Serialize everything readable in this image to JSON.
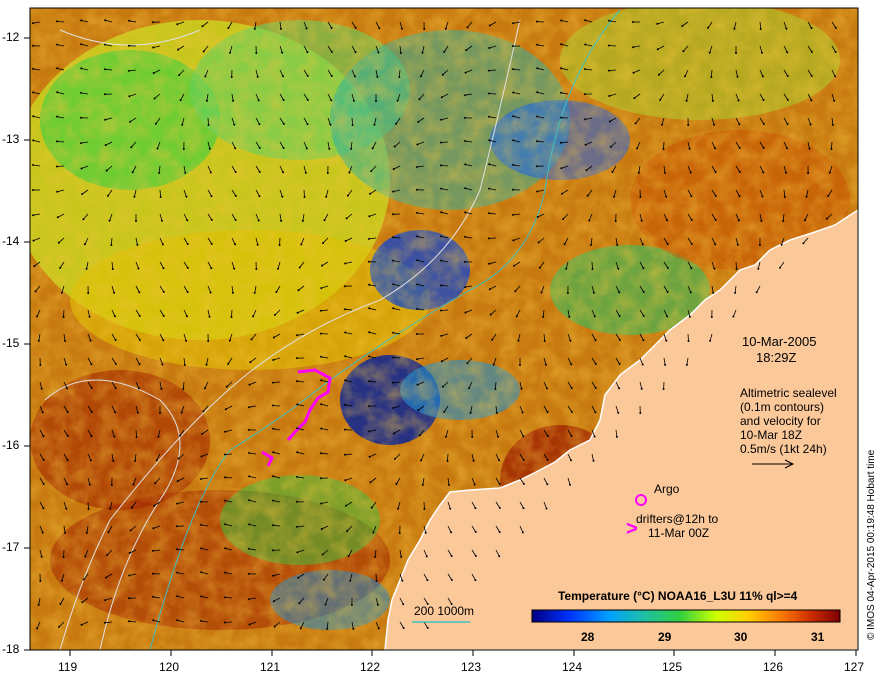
{
  "map": {
    "datetime_line1": "10-Mar-2005",
    "datetime_line2": "18:29Z",
    "altimetry_lines": [
      "Altimetric sealevel",
      "(0.1m contours)",
      "and velocity for",
      "10-Mar 18Z",
      "0.5m/s (1kt 24h)"
    ],
    "argo_label": "Argo",
    "drifters_lines": [
      "drifters@12h to",
      "11-Mar 00Z"
    ],
    "drifter_symbol": ">",
    "depth_legend": "200  1000m",
    "credit": "© IMOS 04-Apr-2015 00:19:48 Hobart time",
    "colors": {
      "land": "#fbc89a",
      "ocean_warm": "#c87a10",
      "drifter": "#ff00ff",
      "bathymetry": "#40c0c0"
    },
    "x_ticks": [
      "119",
      "120",
      "121",
      "122",
      "123",
      "124",
      "125",
      "126",
      "127"
    ],
    "y_ticks": [
      "-12",
      "-13",
      "-14",
      "-15",
      "-16",
      "-17",
      "-18"
    ],
    "colorbar": {
      "title": "Temperature (°C) NOAA16_L3U 11% ql>=4",
      "ticks": [
        "28",
        "29",
        "30",
        "31"
      ],
      "range": [
        27.0,
        31.5
      ]
    }
  }
}
